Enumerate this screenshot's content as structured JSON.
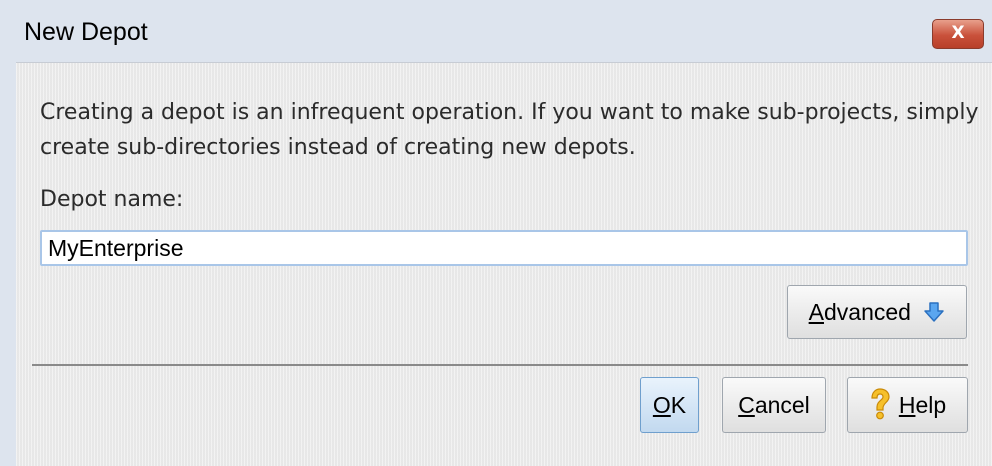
{
  "window": {
    "title": "New Depot",
    "close_label": "X"
  },
  "dialog": {
    "message": "Creating a depot is an infrequent operation. If you want to make sub-projects, simply create sub-directories instead of creating new depots.",
    "depot_name_label": "Depot name:",
    "depot_name_value": "MyEnterprise"
  },
  "buttons": {
    "advanced": {
      "mnemonic": "A",
      "rest": "dvanced"
    },
    "ok": {
      "mnemonic": "O",
      "rest": "K"
    },
    "cancel": {
      "mnemonic": "C",
      "rest": "ancel"
    },
    "help": {
      "mnemonic": "H",
      "rest": "elp"
    }
  },
  "icons": {
    "advanced_icon": "arrow-down-icon",
    "help_icon": "question-mark-icon",
    "close_icon": "close-icon"
  },
  "colors": {
    "title_bar": "#dde4ee",
    "close_button": "#c9513b",
    "input_border": "#a9c6e8",
    "ok_button": "#d5e6f6",
    "arrow_icon": "#3d8ee0",
    "help_icon": "#f2b21b"
  }
}
